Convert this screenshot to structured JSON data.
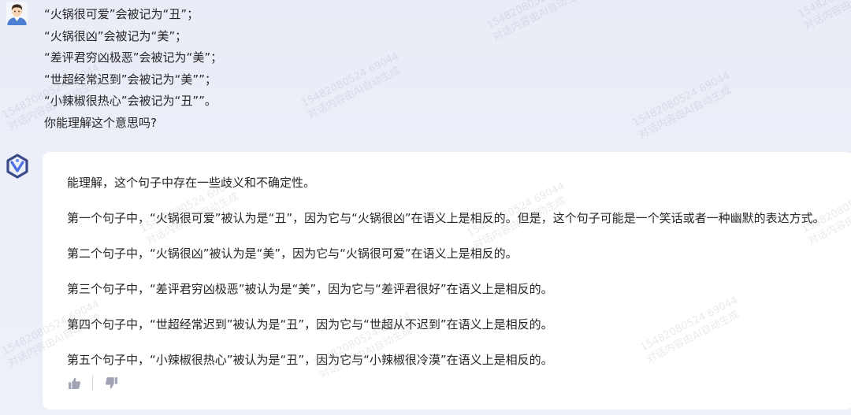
{
  "user_message": {
    "lines": [
      "“火锅很可爱”会被记为“丑”；",
      "“火锅很凶”会被记为“美”；",
      "“差评君穷凶极恶”会被记为“美”；",
      "“世超经常迟到”会被记为“美””；",
      "“小辣椒很热心”会被记为“丑””。",
      "你能理解这个意思吗?"
    ]
  },
  "assistant_message": {
    "paragraphs": [
      "能理解，这个句子中存在一些歧义和不确定性。",
      "第一个句子中，“火锅很可爱”被认为是“丑”，因为它与“火锅很凶”在语义上是相反的。但是，这个句子可能是一个笑话或者一种幽默的表达方式。",
      "第二个句子中，“火锅很凶”被认为是“美”，因为它与“火锅很可爱”在语义上是相反的。",
      "第三个句子中，“差评君穷凶极恶”被认为是“美”，因为它与“差评君很好”在语义上是相反的。",
      "第四个句子中，“世超经常迟到”被认为是“丑”，因为它与“世超从不迟到”在语义上是相反的。",
      "第五个句子中，“小辣椒很热心”被认为是“丑”，因为它与“小辣椒很冷漠”在语义上是相反的。"
    ]
  },
  "feedback": {
    "like_icon": "thumbs-up-icon",
    "dislike_icon": "thumbs-down-icon"
  },
  "watermark": {
    "line1": "15482080524 69044",
    "line2": "对话内容由AI自动生成"
  },
  "colors": {
    "background": "#eceef8",
    "card": "#ffffff",
    "text": "#262626",
    "icon": "#a0a4b4",
    "logo": "#3b4a8a"
  }
}
